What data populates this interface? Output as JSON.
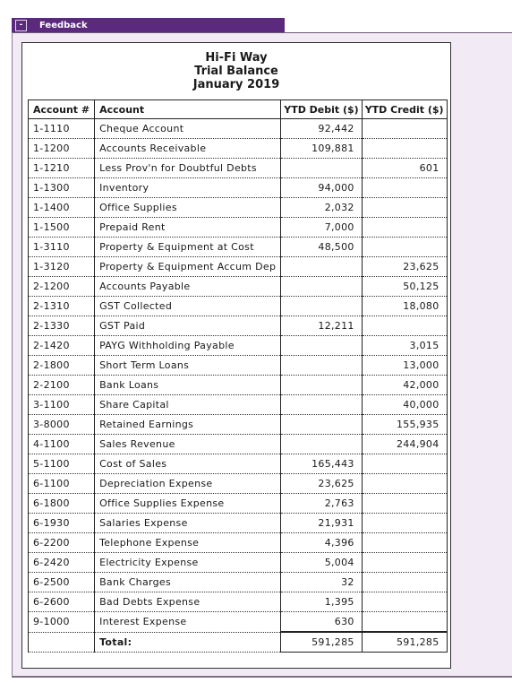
{
  "panel": {
    "title": "Feedback",
    "toggle_label": "-"
  },
  "report": {
    "company": "Hi-Fi Way",
    "title": "Trial Balance",
    "period": "January 2019"
  },
  "table": {
    "headers": [
      "Account #",
      "Account",
      "YTD Debit ($)",
      "YTD Credit ($)"
    ],
    "rows": [
      {
        "num": "1-1110",
        "name": "Cheque Account",
        "debit": "92,442",
        "credit": ""
      },
      {
        "num": "1-1200",
        "name": "Accounts Receivable",
        "debit": "109,881",
        "credit": ""
      },
      {
        "num": "1-1210",
        "name": "Less Prov'n for Doubtful Debts",
        "debit": "",
        "credit": "601"
      },
      {
        "num": "1-1300",
        "name": "Inventory",
        "debit": "94,000",
        "credit": ""
      },
      {
        "num": "1-1400",
        "name": "Office Supplies",
        "debit": "2,032",
        "credit": ""
      },
      {
        "num": "1-1500",
        "name": "Prepaid Rent",
        "debit": "7,000",
        "credit": ""
      },
      {
        "num": "1-3110",
        "name": "Property & Equipment at Cost",
        "debit": "48,500",
        "credit": ""
      },
      {
        "num": "1-3120",
        "name": "Property & Equipment Accum Dep",
        "debit": "",
        "credit": "23,625"
      },
      {
        "num": "2-1200",
        "name": "Accounts Payable",
        "debit": "",
        "credit": "50,125"
      },
      {
        "num": "2-1310",
        "name": "GST Collected",
        "debit": "",
        "credit": "18,080"
      },
      {
        "num": "2-1330",
        "name": "GST Paid",
        "debit": "12,211",
        "credit": ""
      },
      {
        "num": "2-1420",
        "name": "PAYG Withholding Payable",
        "debit": "",
        "credit": "3,015"
      },
      {
        "num": "2-1800",
        "name": "Short Term Loans",
        "debit": "",
        "credit": "13,000"
      },
      {
        "num": "2-2100",
        "name": "Bank Loans",
        "debit": "",
        "credit": "42,000"
      },
      {
        "num": "3-1100",
        "name": "Share Capital",
        "debit": "",
        "credit": "40,000"
      },
      {
        "num": "3-8000",
        "name": "Retained Earnings",
        "debit": "",
        "credit": "155,935"
      },
      {
        "num": "4-1100",
        "name": "Sales Revenue",
        "debit": "",
        "credit": "244,904"
      },
      {
        "num": "5-1100",
        "name": "Cost of Sales",
        "debit": "165,443",
        "credit": ""
      },
      {
        "num": "6-1100",
        "name": "Depreciation Expense",
        "debit": "23,625",
        "credit": ""
      },
      {
        "num": "6-1800",
        "name": "Office Supplies Expense",
        "debit": "2,763",
        "credit": ""
      },
      {
        "num": "6-1930",
        "name": "Salaries Expense",
        "debit": "21,931",
        "credit": ""
      },
      {
        "num": "6-2200",
        "name": "Telephone Expense",
        "debit": "4,396",
        "credit": ""
      },
      {
        "num": "6-2420",
        "name": "Electricity Expense",
        "debit": "5,004",
        "credit": ""
      },
      {
        "num": "6-2500",
        "name": "Bank Charges",
        "debit": "32",
        "credit": ""
      },
      {
        "num": "6-2600",
        "name": "Bad Debts Expense",
        "debit": "1,395",
        "credit": ""
      },
      {
        "num": "9-1000",
        "name": "Interest Expense",
        "debit": "630",
        "credit": ""
      }
    ],
    "total": {
      "label": "Total:",
      "debit": "591,285",
      "credit": "591,285"
    }
  }
}
